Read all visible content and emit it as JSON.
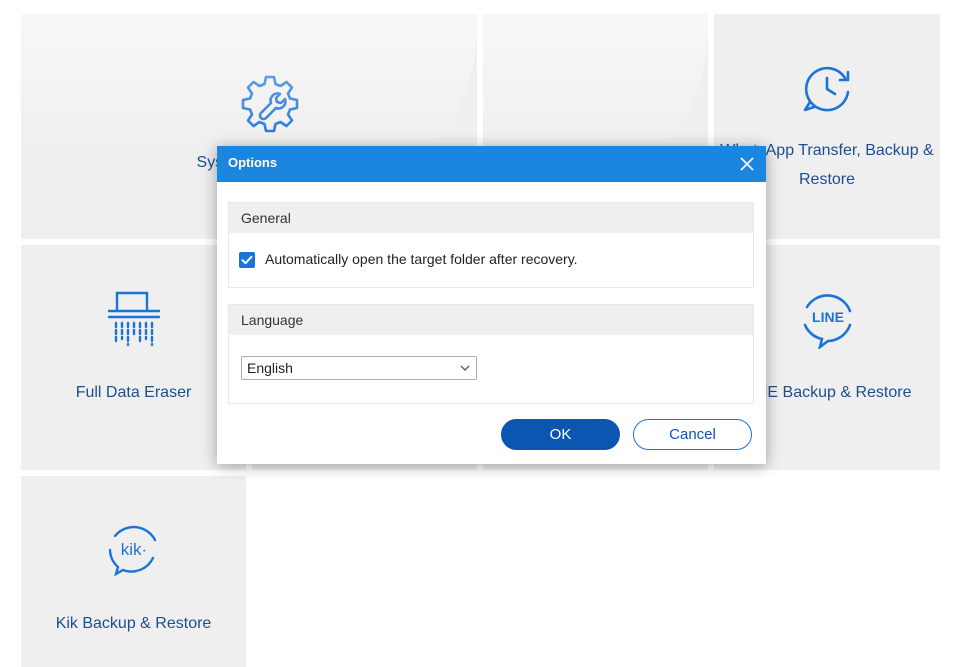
{
  "tiles": {
    "system_repair": {
      "label": "System Repair",
      "icon": "gear-wrench-icon"
    },
    "whatsapp": {
      "label": "WhatsApp Transfer, Backup & Restore",
      "icon": "whatsapp-clock-icon"
    },
    "full_data_eraser": {
      "label": "Full Data Eraser",
      "icon": "shredder-icon"
    },
    "line": {
      "label": "LINE Backup & Restore",
      "icon": "line-icon",
      "icon_text": "LINE"
    },
    "kik": {
      "label": "Kik Backup & Restore",
      "icon": "kik-icon",
      "icon_text": "kik·"
    }
  },
  "dialog": {
    "title": "Options",
    "general": {
      "heading": "General",
      "auto_open_label": "Automatically open the target folder after recovery.",
      "auto_open_checked": true
    },
    "language": {
      "heading": "Language",
      "selected": "English"
    },
    "ok_label": "OK",
    "cancel_label": "Cancel"
  },
  "colors": {
    "accent": "#1a86e0",
    "primary_button": "#0b56b0",
    "tile_bg": "#efefef",
    "label_text": "#1b4f8f"
  }
}
